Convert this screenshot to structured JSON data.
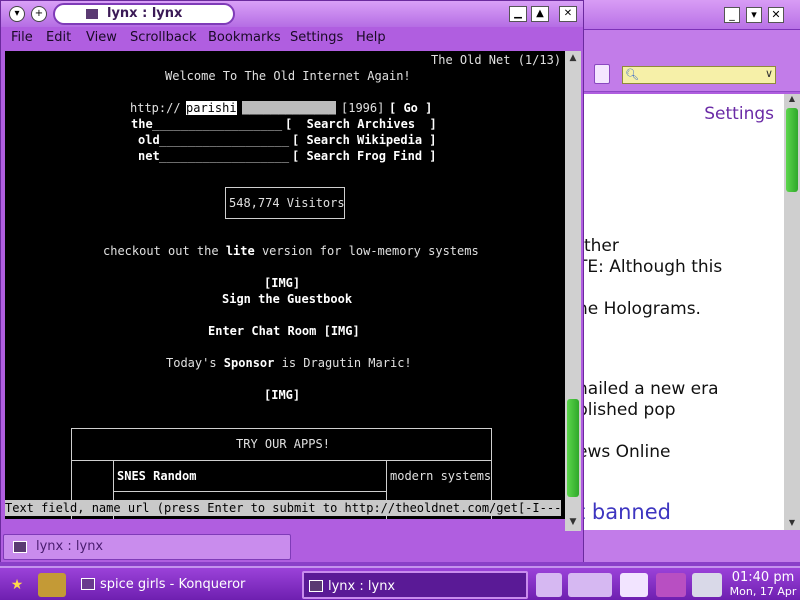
{
  "colors": {
    "accent": "#b05ee0",
    "taskbar": "#7a28bf",
    "terminal_bg": "#000000",
    "scroll_thumb": "#3cbf33"
  },
  "konqueror": {
    "window_buttons": [
      "_",
      "▾",
      "✕"
    ],
    "address_icon": "search-icon",
    "page": {
      "settings_link": "Settings",
      "lines": [
        "rther",
        "TE: Although this",
        "he Holograms.",
        "hailed a new era",
        "blished pop",
        "ews Online"
      ],
      "banned_text": "t banned"
    }
  },
  "lynx": {
    "title": "lynx : lynx",
    "window_buttons": [
      "▁",
      "▲",
      "✕"
    ],
    "menu": [
      "File",
      "Edit",
      "View",
      "Scrollback",
      "Bookmarks",
      "Settings",
      "Help"
    ],
    "terminal": {
      "page_title": "The Old Net (1/13)",
      "welcome": "Welcome To The Old Internet Again!",
      "url_prefix": "http://",
      "url_value": "parishi",
      "url_placeholder": "_____________",
      "year": "[1996]",
      "go": "[ Go ]",
      "rows": [
        {
          "label": "the",
          "blank": "__________________",
          "button": "[  Search Archives  ]"
        },
        {
          "label": "old",
          "blank": "__________________",
          "button": "[ Search Wikipedia ]"
        },
        {
          "label": "net",
          "blank": "__________________",
          "button": "[ Search Frog Find ]"
        }
      ],
      "visitors": "548,774 Visitors",
      "checkout_pre": "checkout out the ",
      "checkout_link": "lite",
      "checkout_post": " version for low-memory systems",
      "img1": "[IMG]",
      "guestbook": "Sign the Guestbook",
      "chat": "Enter Chat Room [IMG]",
      "sponsor_pre": "Today's ",
      "sponsor_bold": "Sponsor",
      "sponsor_post": " is Dragutin Maric!",
      "img2": "[IMG]",
      "apps_heading": "TRY OUR APPS!",
      "app_name": "SNES Random",
      "app_side": "modern systems"
    },
    "status_line": "Text field, name url (press Enter to submit to http://theoldnet.com/get[-I----]",
    "tab_label": "lynx : lynx"
  },
  "taskbar": {
    "tasks": [
      {
        "label": "spice girls - Konqueror",
        "icon": "konqueror-icon"
      },
      {
        "label": "lynx : lynx",
        "icon": "terminal-icon"
      }
    ],
    "clock": {
      "time": "01:40 pm",
      "date": "Mon, 17 Apr"
    }
  }
}
